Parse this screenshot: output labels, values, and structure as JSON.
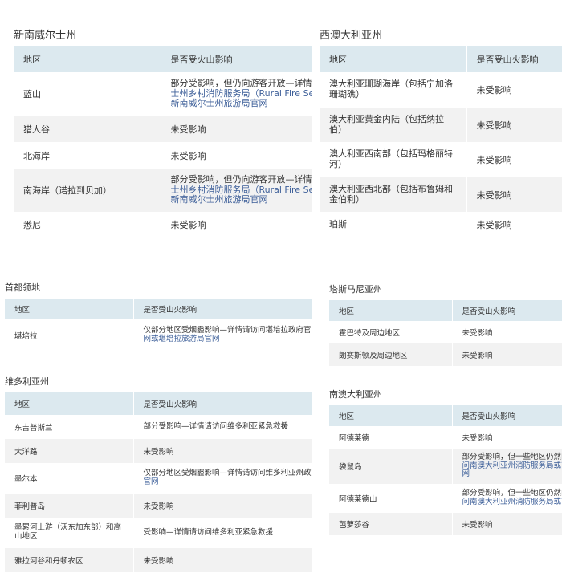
{
  "nsw": {
    "title": "新南威尔士州",
    "header": [
      "地区",
      "是否受火山影响"
    ],
    "rows": [
      {
        "region": "蓝山",
        "status_lines": [
          "部分受影响，但仍向游客开放—详情请访问新南威尔",
          "士州乡村消防服务局（Rural Fire Service）或",
          "新南威尔士州旅游局官网"
        ]
      },
      {
        "region": "猎人谷",
        "status_lines": [
          "未受影响"
        ]
      },
      {
        "region": "北海岸",
        "status_lines": [
          "未受影响"
        ]
      },
      {
        "region": "南海岸（诺拉到贝加）",
        "status_lines": [
          "部分受影响，但仍向游客开放—详情请访问新南威尔",
          "士州乡村消防服务局（Rural Fire Service）或",
          "新南威尔士州旅游局官网"
        ]
      },
      {
        "region": "悉尼",
        "status_lines": [
          "未受影响"
        ]
      }
    ]
  },
  "wa": {
    "title": "西澳大利亚州",
    "header": [
      "地区",
      "是否受山火影响"
    ],
    "rows": [
      {
        "region_lines": [
          "澳大利亚珊瑚海岸（包括宁加洛",
          "珊瑚礁）"
        ],
        "status": "未受影响"
      },
      {
        "region_lines": [
          "澳大利亚黄金内陆（包括纳拉",
          "伯）"
        ],
        "status": "未受影响"
      },
      {
        "region_lines": [
          "澳大利亚西南部（包括玛格丽特",
          "河）"
        ],
        "status": "未受影响"
      },
      {
        "region_lines": [
          "澳大利亚西北部（包括布鲁姆和",
          "金伯利）"
        ],
        "status": "未受影响"
      },
      {
        "region_lines": [
          "珀斯"
        ],
        "status": "未受影响"
      }
    ]
  },
  "act": {
    "title": "首都领地",
    "header": [
      "地区",
      "是否受山火影响"
    ],
    "rows": [
      {
        "region": "堪培拉",
        "status_lines": [
          "仅部分地区受烟霾影响—详情请访问堪培拉政府官",
          "网或堪培拉旅游局官网"
        ]
      }
    ]
  },
  "vic": {
    "title": "维多利亚州",
    "header": [
      "地区",
      "是否受山火影响"
    ],
    "rows": [
      {
        "region_lines": [
          "东吉普斯兰"
        ],
        "status_lines": [
          "部分受影响—详情请访问维多利亚紧急救援"
        ]
      },
      {
        "region_lines": [
          "大洋路"
        ],
        "status_lines": [
          "未受影响"
        ]
      },
      {
        "region_lines": [
          "墨尔本"
        ],
        "status_lines": [
          "仅部分地区受烟霾影响—详情请访问维多利亚州政府",
          "官网"
        ]
      },
      {
        "region_lines": [
          "菲利普岛"
        ],
        "status_lines": [
          "未受影响"
        ]
      },
      {
        "region_lines": [
          "墨累河上游（沃东加东部）和高",
          "山地区"
        ],
        "status_lines": [
          "受影响—详情请访问维多利亚紧急救援"
        ]
      },
      {
        "region_lines": [
          "雅拉河谷和丹顿农区"
        ],
        "status_lines": [
          "未受影响"
        ]
      }
    ]
  },
  "tas": {
    "title": "塔斯马尼亚州",
    "header": [
      "地区",
      "是否受山火影响"
    ],
    "rows": [
      {
        "region": "霍巴特及周边地区",
        "status": "未受影响"
      },
      {
        "region": "朗赛斯顿及周边地区",
        "status": "未受影响"
      }
    ]
  },
  "sa": {
    "title": "南澳大利亚州",
    "header": [
      "地区",
      "是否受山火影响"
    ],
    "rows": [
      {
        "region": "阿德莱德",
        "status_lines": [
          "未受影响"
        ]
      },
      {
        "region": "袋鼠岛",
        "status_lines": [
          "部分受影响，但一些地区仍然向游客开放—详情请访",
          "问南澳大利亚州消防服务局或南澳大利亚州旅游局官",
          "网"
        ]
      },
      {
        "region": "阿德莱德山",
        "status_lines": [
          "部分受影响，但一些地区仍然向游客开放—详情请访",
          "问南澳大利亚州消防服务局或南澳大利亚州旅游局官网"
        ]
      },
      {
        "region": "芭萝莎谷",
        "status_lines": [
          "未受影响"
        ]
      }
    ]
  },
  "colors": {
    "header_bg": "#dce9ef",
    "row_alt_bg": "#f2f2f2",
    "link": "#3d5f99",
    "text": "#333333"
  }
}
